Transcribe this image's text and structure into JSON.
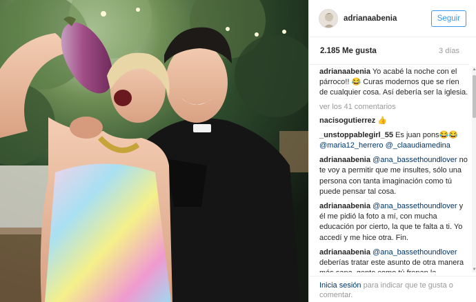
{
  "post": {
    "username": "adrianaabenia",
    "follow_label": "Seguir",
    "likes": "2.185 Me gusta",
    "time_ago": "3 días"
  },
  "comments": [
    {
      "user": "adrianaabenia",
      "text": "Yo acabé la noche con el párroco!! 😂 Curas modernos que se ríen de cualquier cosa. Así debería ser la iglesia."
    },
    {
      "user": "nacisogutierrez",
      "text": "👍"
    },
    {
      "user": "_unstoppablegirl_55",
      "text": "Es juan pons😂😂",
      "mentions": [
        "@maria12_herrero",
        "@_claaudiamedina"
      ]
    },
    {
      "user": "adrianaabenia",
      "mention": "@ana_bassethoundlover",
      "text": "no te voy a permitir que me insultes, sólo una persona con tanta imaginación como tú puede pensar tal cosa."
    },
    {
      "user": "adrianaabenia",
      "mention": "@ana_bassethoundlover",
      "text": "y él me pidió la foto a mí, con mucha educación por cierto, la que te falta a ti. Yo accedí y me hice otra. Fin."
    },
    {
      "user": "adrianaabenia",
      "mention": "@ana_bassethoundlover",
      "text": "deberías tratar este asunto de otra manera más sana, gente como tú frenan la normalización de estas cosas. Una"
    }
  ],
  "view_more": "ver los 41 comentarios",
  "footer": {
    "login": "Inicia sesión",
    "rest": "para indicar que te gusta o comentar."
  },
  "icons": {
    "avatar": "profile-avatar",
    "scroll_up": "scroll-up-arrow-icon",
    "scroll_down": "scroll-down-arrow-icon"
  },
  "colors": {
    "follow_blue": "#3897f0",
    "link_blue": "#003569",
    "muted": "#999999"
  }
}
